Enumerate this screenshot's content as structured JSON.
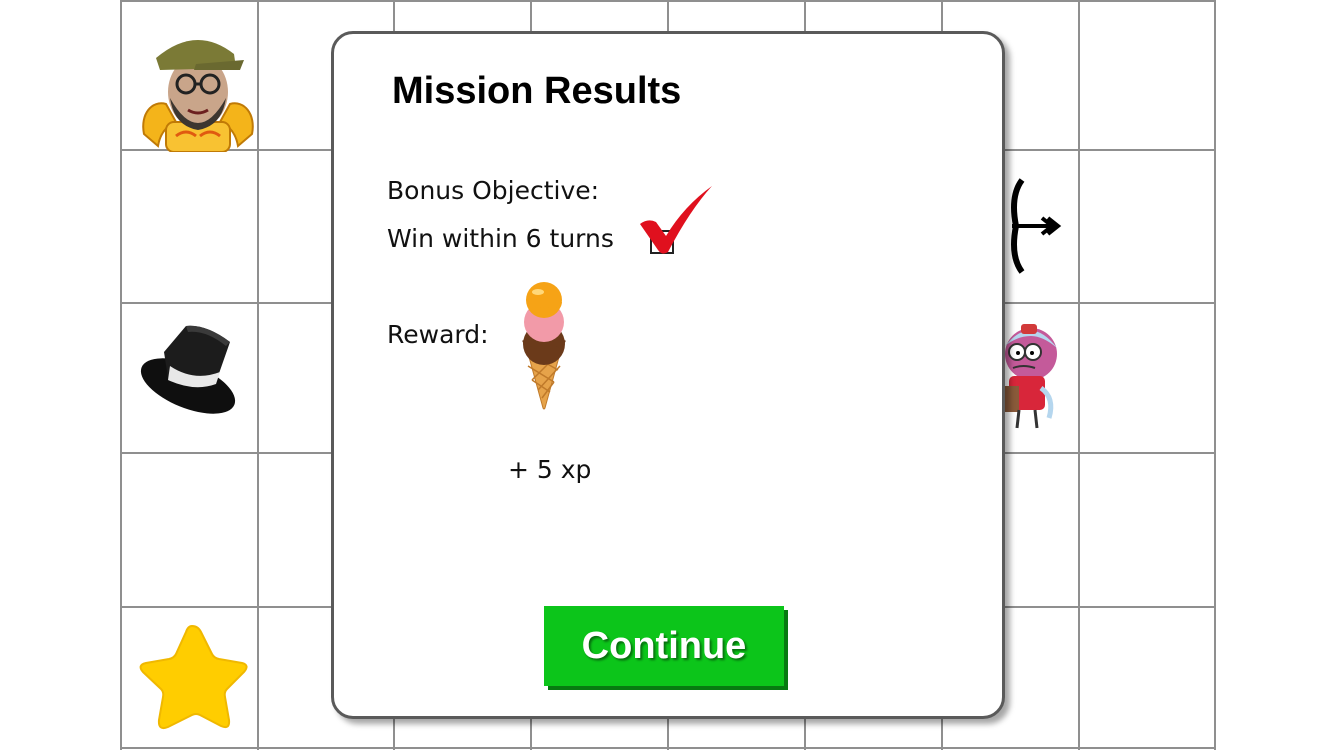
{
  "board": {
    "pieces": {
      "player": "player-avatar-icon",
      "top_hat": "top-hat-icon",
      "star": "star-icon",
      "arrow": "arrow-icon",
      "enemy": "enemy-character-icon"
    }
  },
  "modal": {
    "title": "Mission Results",
    "bonus_label": "Bonus Objective:",
    "bonus_text": "Win within 6 turns",
    "bonus_completed": true,
    "reward_label": "Reward:",
    "reward_icon": "ice-cream-icon",
    "reward_xp": "+ 5 xp",
    "continue_label": "Continue"
  },
  "colors": {
    "continue_button": "#0cc51a",
    "check_mark": "#e0101e",
    "grid": "#8f8f8f"
  }
}
